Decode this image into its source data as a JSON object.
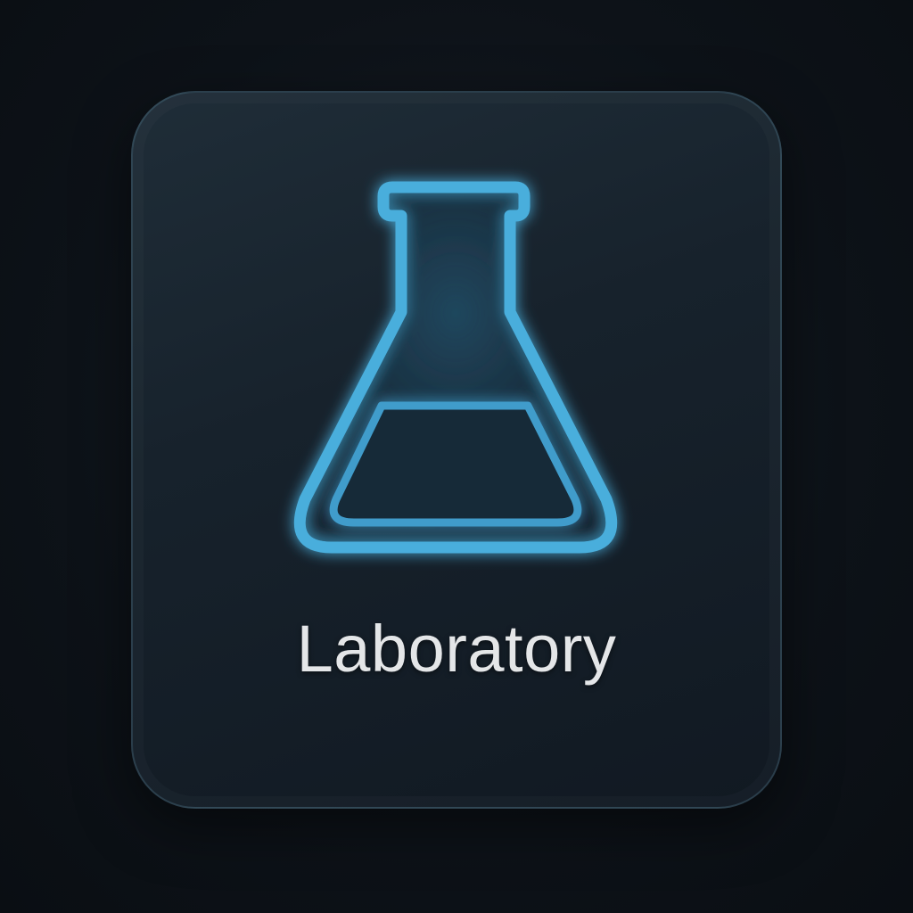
{
  "app_tile": {
    "label": "Laboratory",
    "icon": "flask-icon",
    "accent_color": "#4fb3e0"
  }
}
